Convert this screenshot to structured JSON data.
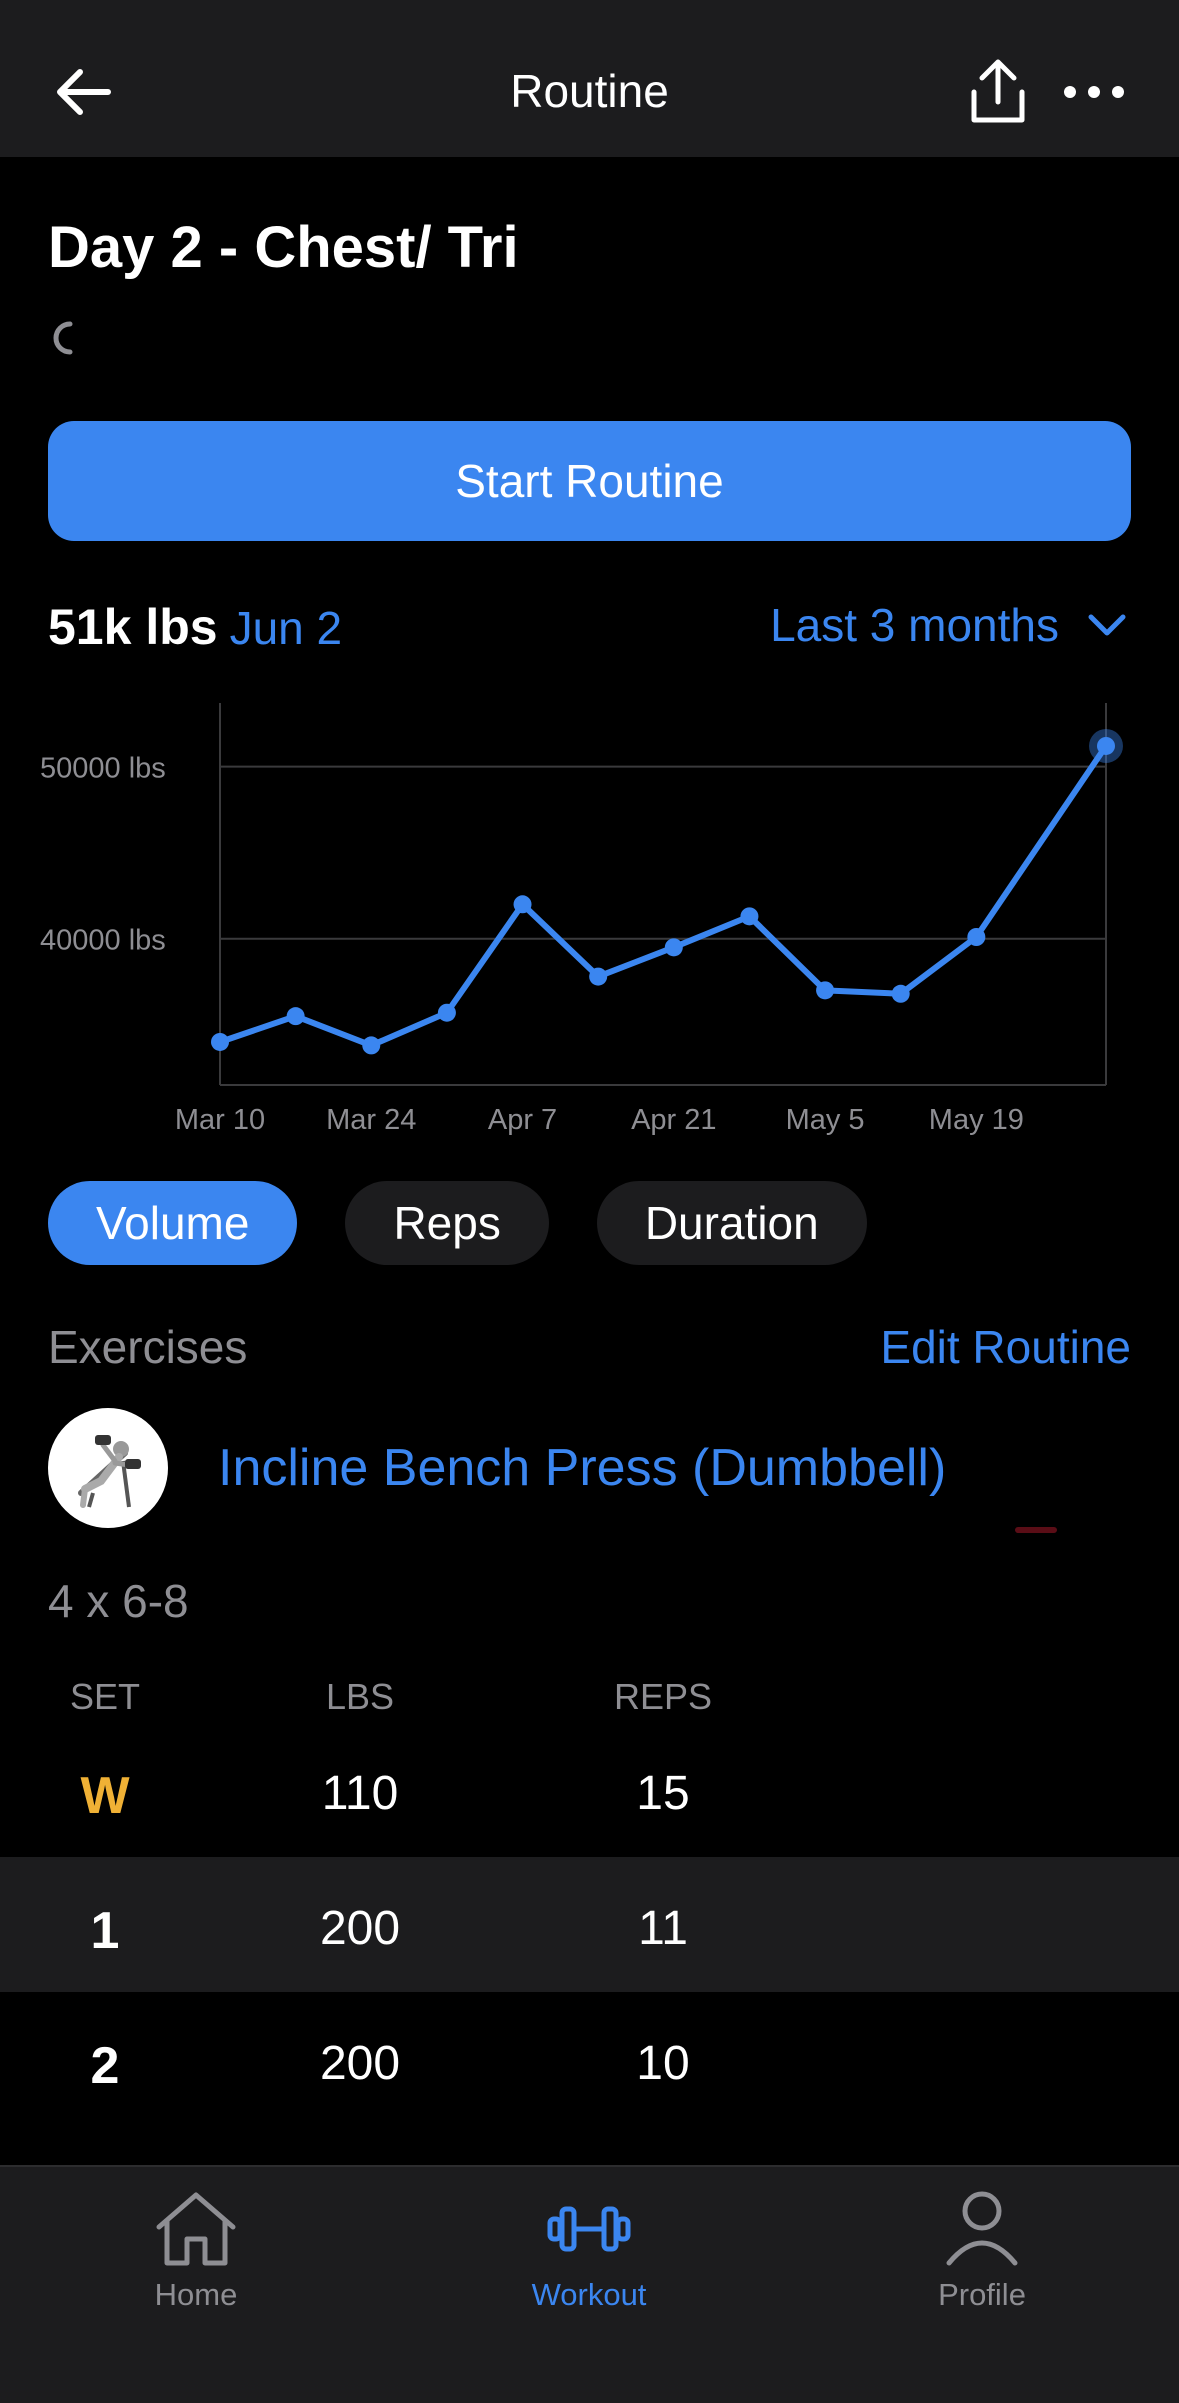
{
  "header": {
    "title": "Routine"
  },
  "routine": {
    "name": "Day 2 - Chest/ Tri",
    "start_label": "Start Routine"
  },
  "summary": {
    "value": "51k lbs",
    "date": "Jun 2",
    "range": "Last 3 months"
  },
  "chart_data": {
    "type": "line",
    "x": [
      "Mar 10",
      "Mar 17",
      "Mar 24",
      "Mar 31",
      "Apr 7",
      "Apr 14",
      "Apr 21",
      "Apr 28",
      "May 5",
      "May 12",
      "May 19",
      "Jun 2"
    ],
    "x_days": [
      0,
      7,
      14,
      21,
      28,
      35,
      42,
      49,
      56,
      63,
      70,
      82
    ],
    "series": [
      {
        "values": [
          34000,
          35500,
          33800,
          35700,
          42000,
          37800,
          39500,
          41300,
          37000,
          36800,
          40100,
          51200
        ]
      }
    ],
    "xticks": [
      "Mar 10",
      "Mar 24",
      "Apr 7",
      "Apr 21",
      "May 5",
      "May 19"
    ],
    "yticks": [
      "50000 lbs",
      "40000 lbs"
    ],
    "ytick_values": [
      50000,
      40000
    ],
    "ylim": [
      31500,
      53000
    ],
    "highlight_last": true,
    "color": "#3b86f0",
    "grid": true
  },
  "metric_tabs": [
    "Volume",
    "Reps",
    "Duration"
  ],
  "exercises": {
    "heading": "Exercises",
    "edit_label": "Edit Routine",
    "items": [
      {
        "name": "Incline Bench Press (Dumbbell)",
        "scheme": "4 x 6-8",
        "columns": [
          "SET",
          "LBS",
          "REPS"
        ],
        "sets": [
          {
            "set": "W",
            "lbs": "110",
            "reps": "15"
          },
          {
            "set": "1",
            "lbs": "200",
            "reps": "11"
          },
          {
            "set": "2",
            "lbs": "200",
            "reps": "10"
          }
        ]
      }
    ]
  },
  "tabbar": {
    "items": [
      {
        "label": "Home",
        "icon": "home-icon"
      },
      {
        "label": "Workout",
        "icon": "dumbbell-icon"
      },
      {
        "label": "Profile",
        "icon": "person-icon"
      }
    ]
  },
  "colors": {
    "accent": "#3b86f0",
    "warmup": "#f0b135",
    "surface": "#1c1c1e",
    "muted": "#8e8e93"
  }
}
